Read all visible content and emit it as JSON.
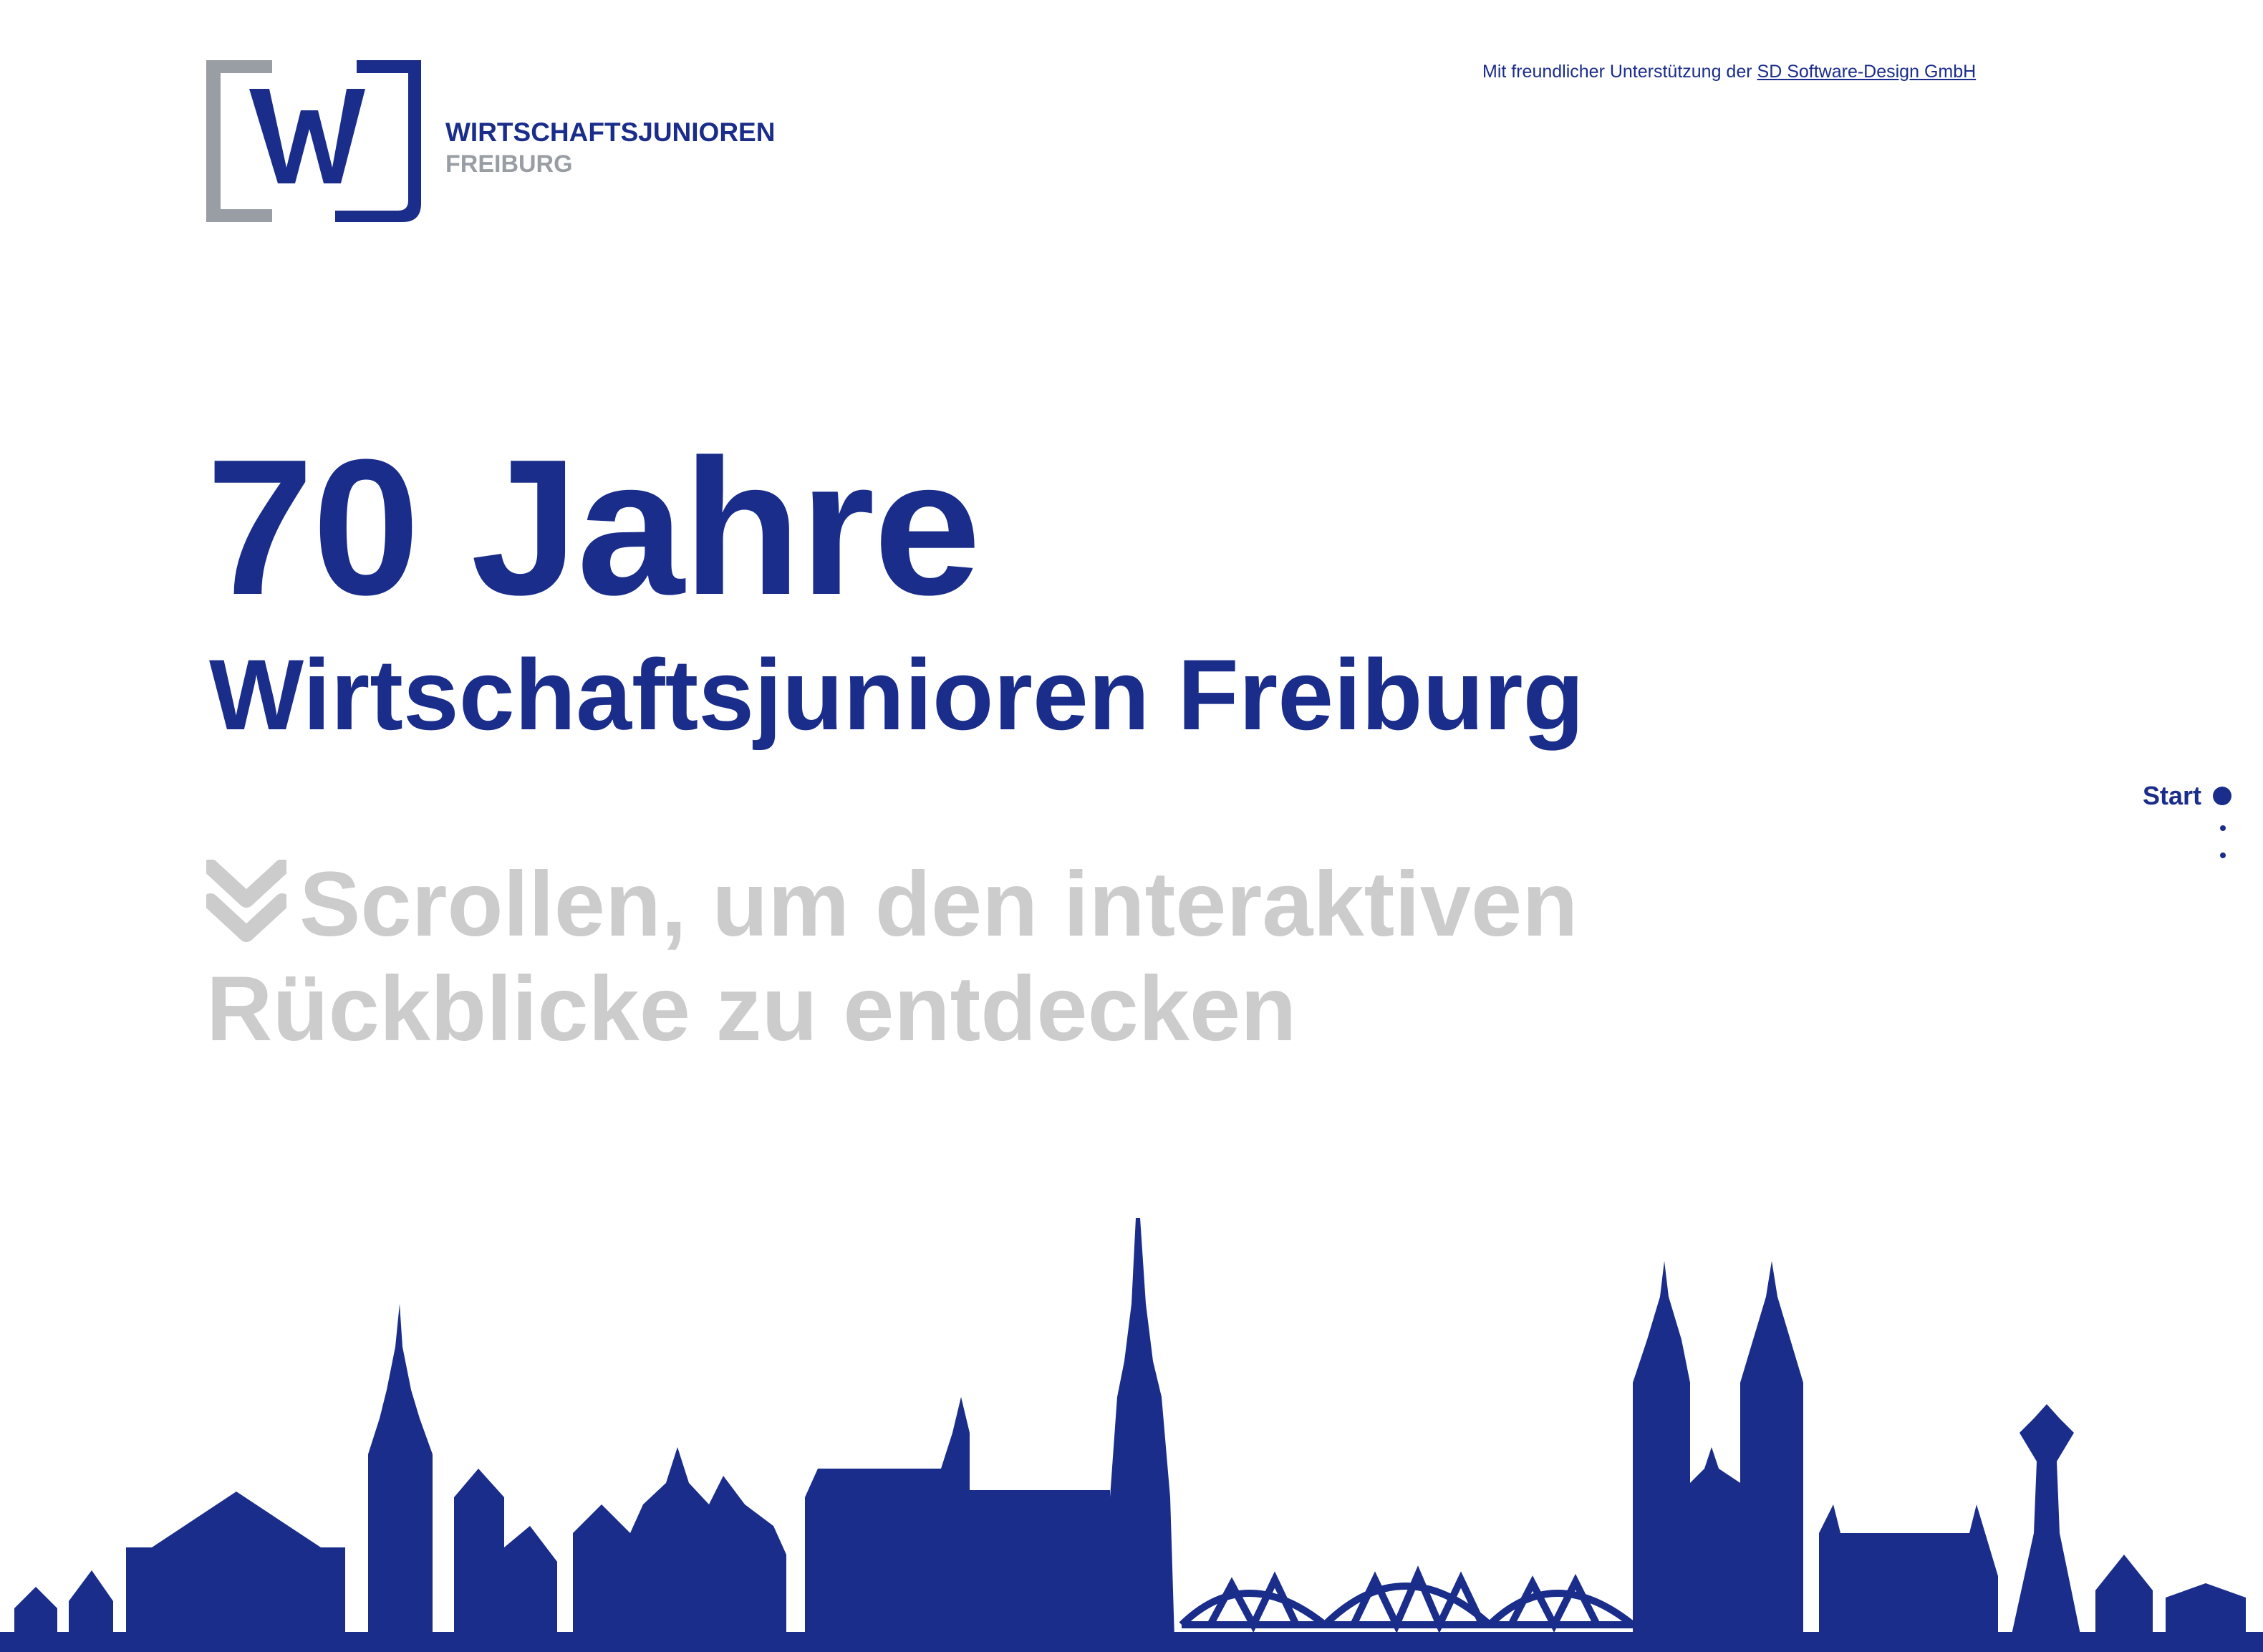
{
  "brand": {
    "logo_text_line1": "WIRTSCHAFTSJUNIOREN",
    "logo_text_line2": "FREIBURG",
    "logo_mark": "[wj]",
    "primary_color": "#1a2d8a",
    "gray_color": "#999ea4"
  },
  "header": {
    "support_prefix": "Mit freundlicher Unterstützung der ",
    "support_link": "SD Software-Design GmbH"
  },
  "hero": {
    "headline": "70 Jahre",
    "subline": "Wirtschaftsjunioren Freiburg",
    "scroll_hint_line1": "Scrollen, um den interaktiven",
    "scroll_hint_line2": "Rückblicke zu entdecken",
    "scroll_icon": "double-chevron-down-icon"
  },
  "nav": {
    "active_label": "Start",
    "dot_count": 3
  }
}
